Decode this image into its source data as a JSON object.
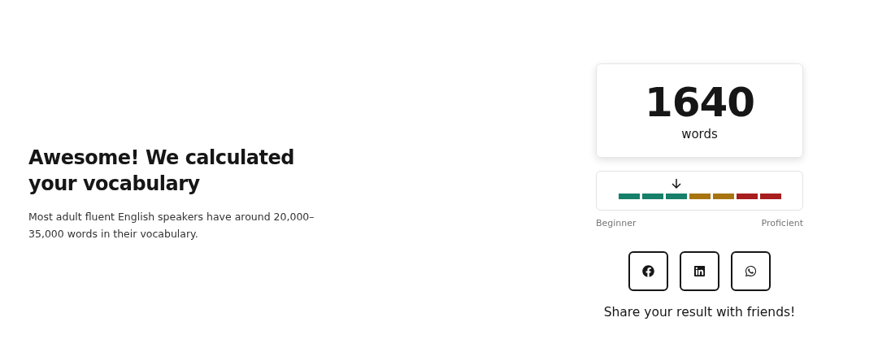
{
  "result": {
    "heading": "Awesome! We calculated your vocabulary",
    "description": "Most adult fluent English speakers have around 20,000–35,000 words in their vocabulary."
  },
  "score": {
    "value": "1640",
    "unit": "words"
  },
  "meter": {
    "level": 0.357,
    "segments": [
      {
        "color": "#16806a"
      },
      {
        "color": "#16806a"
      },
      {
        "color": "#16806a"
      },
      {
        "color": "#a87410"
      },
      {
        "color": "#a87410"
      },
      {
        "color": "#a81d1d"
      },
      {
        "color": "#a81d1d"
      }
    ],
    "min_label": "Beginner",
    "max_label": "Proficient"
  },
  "share": {
    "buttons": [
      {
        "kind": "facebook"
      },
      {
        "kind": "linkedin"
      },
      {
        "kind": "whatsapp"
      }
    ],
    "caption": "Share your result with friends!"
  }
}
